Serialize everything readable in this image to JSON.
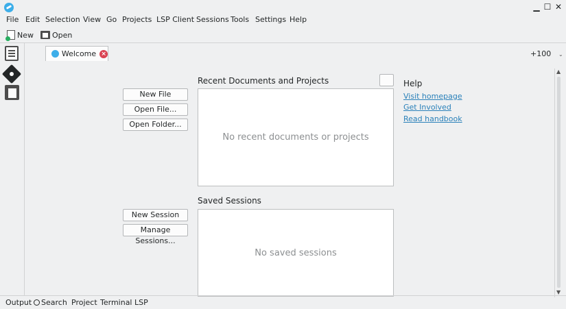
{
  "window": {
    "minimize": "▁",
    "maximize": "☐",
    "close": "✕"
  },
  "menubar": {
    "items": [
      "File",
      "Edit",
      "Selection",
      "View",
      "Go",
      "Projects",
      "LSP Client",
      "Sessions",
      "Tools",
      "Settings",
      "Help"
    ]
  },
  "toolbar": {
    "new_label": "New",
    "open_label": "Open"
  },
  "tabs": [
    {
      "label": "Welcome",
      "icon": "globe-icon",
      "close_icon": "close-icon"
    }
  ],
  "zoom_label": "+100",
  "welcome": {
    "recent": {
      "title": "Recent Documents and Projects",
      "empty_text": "No recent documents or projects",
      "buttons": [
        "New File",
        "Open File...",
        "Open Folder..."
      ]
    },
    "sessions": {
      "title": "Saved Sessions",
      "empty_text": "No saved sessions",
      "buttons": [
        "New Session",
        "Manage Sessions..."
      ]
    },
    "help": {
      "title": "Help",
      "links": [
        "Visit homepage",
        "Get Involved",
        "Read handbook"
      ]
    }
  },
  "bottombar": {
    "items": [
      "Output",
      "Search",
      "Project",
      "Terminal",
      "LSP"
    ]
  },
  "colors": {
    "accent": "#3daee9",
    "link": "#2980b9",
    "close": "#da4453"
  }
}
